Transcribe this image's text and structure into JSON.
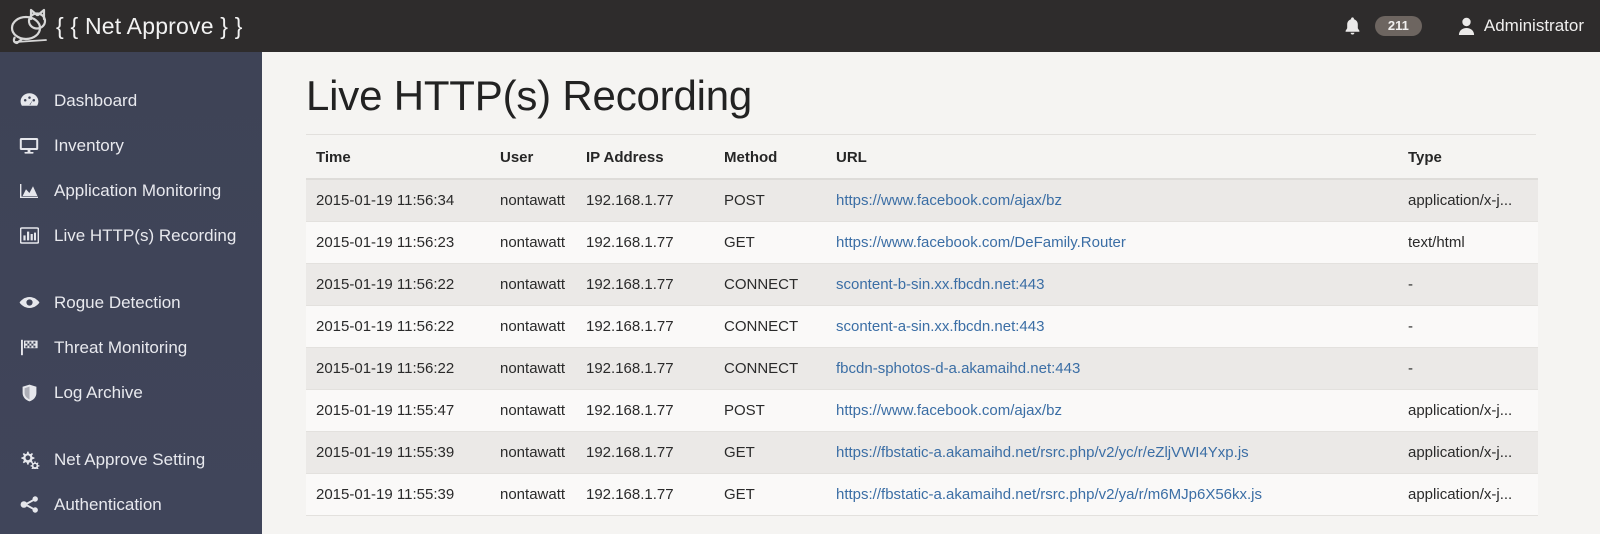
{
  "header": {
    "logo_icon": "cat-logo-icon",
    "brand_title": "{ { Net Approve } }",
    "bell_icon": "bell-icon",
    "notification_count": "211",
    "user_icon": "user-icon",
    "user_name": "Administrator"
  },
  "sidebar": {
    "items": [
      {
        "label": "Dashboard",
        "icon": "dashboard-icon",
        "group": 0
      },
      {
        "label": "Inventory",
        "icon": "monitor-icon",
        "group": 0
      },
      {
        "label": "Application Monitoring",
        "icon": "area-chart-icon",
        "group": 0
      },
      {
        "label": "Live HTTP(s) Recording",
        "icon": "bar-chart-icon",
        "group": 0
      },
      {
        "label": "Rogue Detection",
        "icon": "eye-icon",
        "group": 1
      },
      {
        "label": "Threat Monitoring",
        "icon": "flag-icon",
        "group": 1
      },
      {
        "label": "Log Archive",
        "icon": "shield-icon",
        "group": 1
      },
      {
        "label": "Net Approve Setting",
        "icon": "cogs-icon",
        "group": 2
      },
      {
        "label": "Authentication",
        "icon": "share-icon",
        "group": 2
      }
    ]
  },
  "main": {
    "title": "Live HTTP(s) Recording",
    "table": {
      "columns": [
        "Time",
        "User",
        "IP Address",
        "Method",
        "URL",
        "Type"
      ],
      "rows": [
        {
          "time": "2015-01-19 11:56:34",
          "user": "nontawatt",
          "ip": "192.168.1.77",
          "method": "POST",
          "url": "https://www.facebook.com/ajax/bz",
          "type": "application/x-j..."
        },
        {
          "time": "2015-01-19 11:56:23",
          "user": "nontawatt",
          "ip": "192.168.1.77",
          "method": "GET",
          "url": "https://www.facebook.com/DeFamily.Router",
          "type": "text/html"
        },
        {
          "time": "2015-01-19 11:56:22",
          "user": "nontawatt",
          "ip": "192.168.1.77",
          "method": "CONNECT",
          "url": "scontent-b-sin.xx.fbcdn.net:443",
          "type": "-"
        },
        {
          "time": "2015-01-19 11:56:22",
          "user": "nontawatt",
          "ip": "192.168.1.77",
          "method": "CONNECT",
          "url": "scontent-a-sin.xx.fbcdn.net:443",
          "type": "-"
        },
        {
          "time": "2015-01-19 11:56:22",
          "user": "nontawatt",
          "ip": "192.168.1.77",
          "method": "CONNECT",
          "url": "fbcdn-sphotos-d-a.akamaihd.net:443",
          "type": "-"
        },
        {
          "time": "2015-01-19 11:55:47",
          "user": "nontawatt",
          "ip": "192.168.1.77",
          "method": "POST",
          "url": "https://www.facebook.com/ajax/bz",
          "type": "application/x-j..."
        },
        {
          "time": "2015-01-19 11:55:39",
          "user": "nontawatt",
          "ip": "192.168.1.77",
          "method": "GET",
          "url": "https://fbstatic-a.akamaihd.net/rsrc.php/v2/yc/r/eZljVWI4Yxp.js",
          "type": "application/x-j..."
        },
        {
          "time": "2015-01-19 11:55:39",
          "user": "nontawatt",
          "ip": "192.168.1.77",
          "method": "GET",
          "url": "https://fbstatic-a.akamaihd.net/rsrc.php/v2/ya/r/m6MJp6X56kx.js",
          "type": "application/x-j..."
        }
      ]
    }
  },
  "colors": {
    "topbar_bg": "#2e2c2c",
    "sidebar_bg": "#3f4457",
    "content_bg": "#f5f4f2",
    "link": "#3b6ea5",
    "badge_bg": "#6d6560",
    "row_stripe": "#ebe9e7"
  }
}
